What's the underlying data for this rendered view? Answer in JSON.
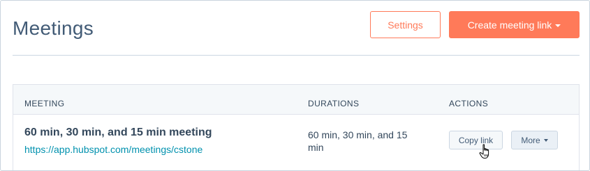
{
  "header": {
    "title": "Meetings",
    "settings_label": "Settings",
    "create_label": "Create meeting link"
  },
  "table": {
    "columns": [
      "MEETING",
      "DURATIONS",
      "ACTIONS"
    ],
    "rows": [
      {
        "name": "60 min, 30 min, and 15 min meeting",
        "link": "https://app.hubspot.com/meetings/cstone",
        "durations": "60 min, 30 min, and 15 min",
        "copy_label": "Copy link",
        "more_label": "More"
      }
    ]
  },
  "colors": {
    "accent": "#ff7a59",
    "link": "#0091ae",
    "text": "#33475b"
  },
  "icons": {
    "caret": "chevron-down-icon",
    "cursor": "hand-pointer-icon"
  }
}
